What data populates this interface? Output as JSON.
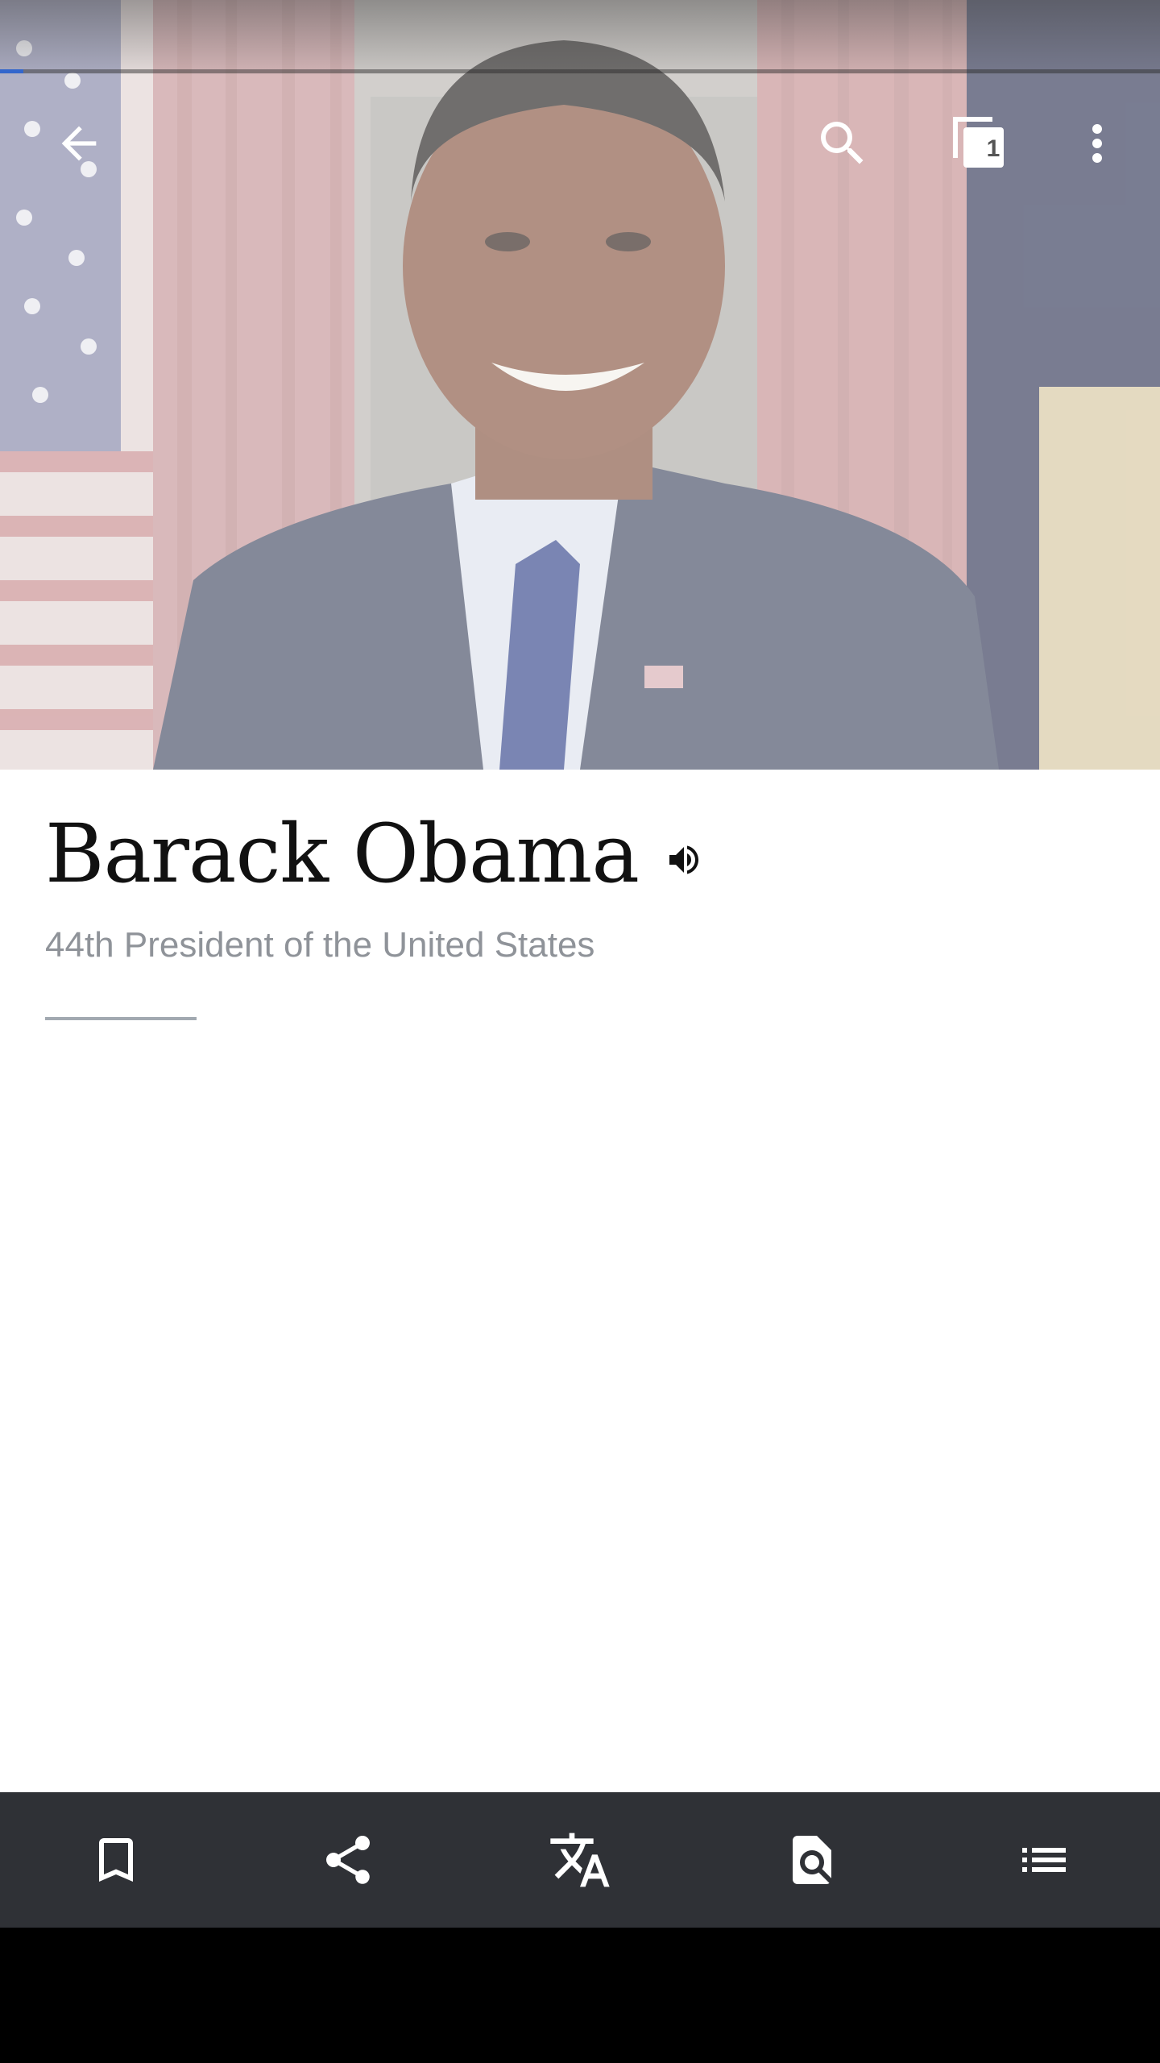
{
  "page": {
    "title": "Barack Obama",
    "description": "44th President of the United States"
  },
  "toolbar": {
    "back_icon": "arrow-back-icon",
    "search_icon": "search-icon",
    "tabs_icon": "tabs-icon",
    "tabs_count": "1",
    "overflow_icon": "more-vert-icon"
  },
  "loading": {
    "progress": 0.02
  },
  "lead_image": {
    "subject": "portrait-photo"
  },
  "audio": {
    "icon": "volume-icon"
  },
  "action_bar": {
    "items": [
      {
        "icon": "bookmark-icon"
      },
      {
        "icon": "share-icon"
      },
      {
        "icon": "translate-icon"
      },
      {
        "icon": "find-in-page-icon"
      },
      {
        "icon": "contents-list-icon"
      }
    ]
  },
  "colors": {
    "action_bar_bg": "#2f3136",
    "accent_blue": "#3366cc",
    "title_text": "#111111",
    "description_text": "#8f9399",
    "divider": "#a2a9b1"
  }
}
